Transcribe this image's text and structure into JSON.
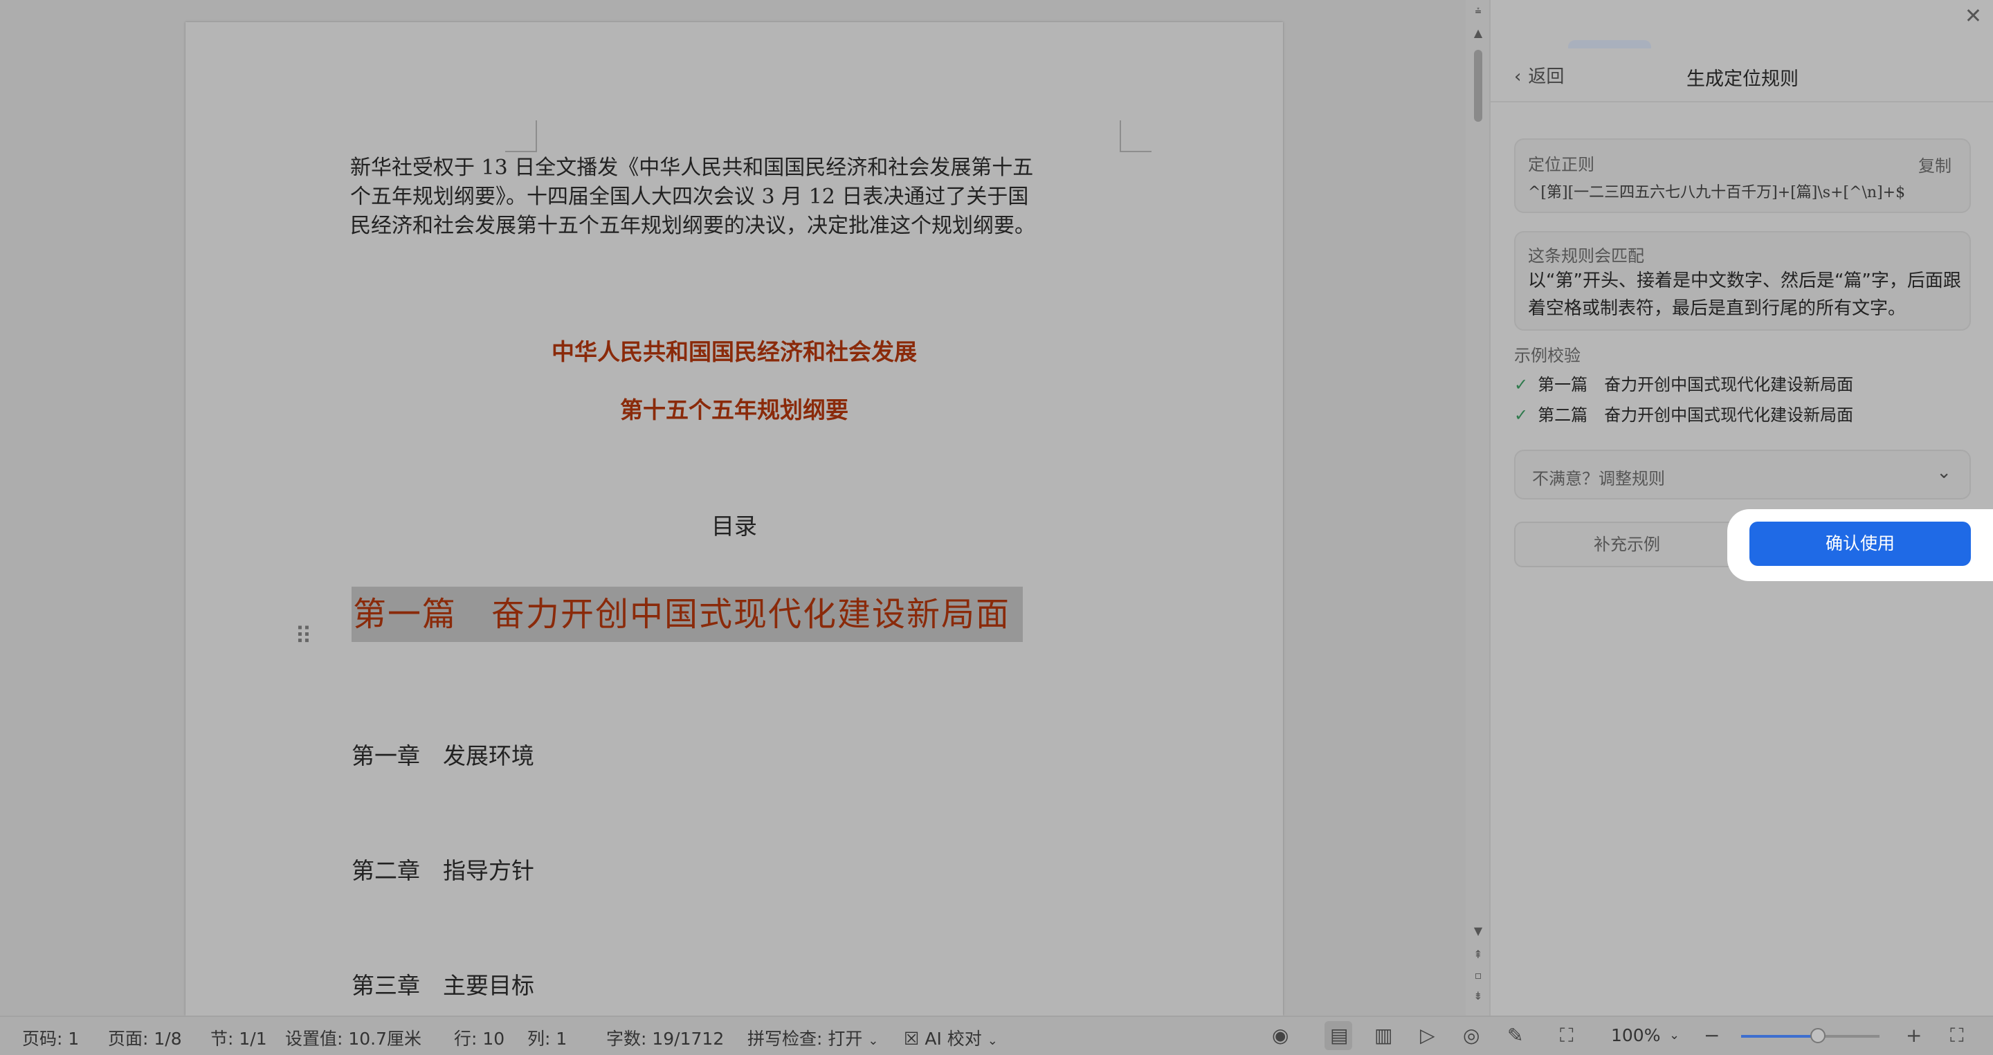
{
  "document": {
    "intro_lines": [
      "新华社受权于 13 日全文播发《中华人民共和国国民经济和社会发展第十五",
      "个五年规划纲要》。十四届全国人大四次会议 3 月 12 日表决通过了关于国",
      "民经济和社会发展第十五个五年规划纲要的决议，决定批准这个规划纲要。"
    ],
    "title_line1": "中华人民共和国国民经济和社会发展",
    "title_line2": "第十五个五年规划纲要",
    "toc_title": "目录",
    "part1": "第一篇　奋力开创中国式现代化建设新局面",
    "chapters": [
      "第一章　发展环境",
      "第二章　指导方针",
      "第三章　主要目标"
    ],
    "drag_handle": "⠿"
  },
  "panel": {
    "back_label": "返回",
    "title": "生成定位规则",
    "regex_label": "定位正则",
    "copy_label": "复制",
    "regex_value": "^[第][一二三四五六七八九十百千万]+[篇]\\s+[^\\n]+$",
    "match_label": "这条规则会匹配",
    "match_text": "以“第”开头、接着是中文数字、然后是“篇”字，后面跟着空格或制表符，最后是直到行尾的所有文字。",
    "examples_title": "示例校验",
    "examples": [
      "第一篇　奋力开创中国式现代化建设新局面",
      "第二篇　奋力开创中国式现代化建设新局面"
    ],
    "check_mark": "✓",
    "adjust_label": "不满意？调整规则",
    "add_example_label": "补充示例",
    "confirm_label": "确认使用",
    "close_icon": "close-icon",
    "accent_color": "#1f6ae6"
  },
  "statusbar": {
    "page_num": "页码: 1",
    "pages": "页面: 1/8",
    "section": "节: 1/1",
    "setting": "设置值: 10.7厘米",
    "row": "行: 10",
    "col": "列: 1",
    "word_count": "字数: 19/1712",
    "spell_check": "拼写检查: 打开",
    "ai_proofread": "AI 校对",
    "zoom": "100%",
    "zoom_level": 0.55
  }
}
